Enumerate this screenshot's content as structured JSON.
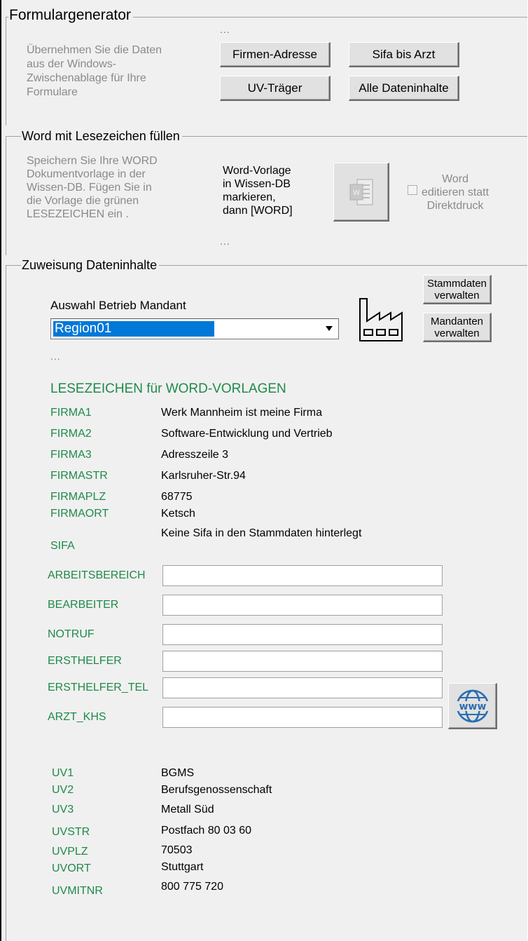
{
  "formulargenerator": {
    "title": "Formulargenerator",
    "desc_lines": [
      "Übernehmen Sie die Daten",
      "aus der Windows-",
      "Zwischenablage für Ihre",
      "Formulare"
    ],
    "dots": "...",
    "btn_firmen_adresse": "Firmen-Adresse",
    "btn_sifa_bis_arzt": "Sifa bis Arzt",
    "btn_uv_traeger": "UV-Träger",
    "btn_alle_dateninhalte": "Alle Dateninhalte"
  },
  "word_section": {
    "title": "Word mit Lesezeichen füllen",
    "desc_lines": [
      "Speichern Sie Ihre WORD",
      "Dokumentvorlage in der",
      "Wissen-DB. Fügen Sie in",
      "die Vorlage die grünen",
      "LESEZEICHEN ein ."
    ],
    "instr_lines": [
      "Word-Vorlage",
      "in Wissen-DB",
      "markieren,",
      "dann [WORD]"
    ],
    "word_button_icon": "word-icon",
    "checkbox_lines": [
      "Word",
      "editieren statt",
      "Direktdruck"
    ],
    "checkbox_checked": false,
    "dots": "..."
  },
  "zuweisung": {
    "title": "Zuweisung Dateninhalte",
    "auswahl_label": "Auswahl Betrieb Mandant",
    "selected_mandant": "Region01",
    "btn_stammdaten": [
      "Stammdaten",
      "verwalten"
    ],
    "btn_mandanten": [
      "Mandanten",
      "verwalten"
    ],
    "factory_icon": "factory-icon",
    "dots": "...",
    "lesezeichen_heading": "LESEZEICHEN für WORD-VORLAGEN",
    "firm_fields": [
      {
        "label": "FIRMA1",
        "value": "Werk Mannheim  ist meine Firma"
      },
      {
        "label": "FIRMA2",
        "value": "Software-Entwicklung und Vertrieb"
      },
      {
        "label": "FIRMA3",
        "value": "Adresszeile 3"
      },
      {
        "label": "FIRMASTR",
        "value": "Karlsruher-Str.94"
      },
      {
        "label": "FIRMAPLZ",
        "value": "68775"
      },
      {
        "label": "FIRMAORT",
        "value": "Ketsch"
      }
    ],
    "sifa_note": "Keine Sifa in den Stammdaten hinterlegt",
    "sifa_label": "SIFA",
    "input_fields": [
      {
        "label": "ARBEITSBEREICH",
        "value": ""
      },
      {
        "label": "BEARBEITER",
        "value": ""
      },
      {
        "label": "NOTRUF",
        "value": ""
      },
      {
        "label": "ERSTHELFER",
        "value": ""
      },
      {
        "label": "ERSTHELFER_TEL",
        "value": ""
      },
      {
        "label": "ARZT_KHS",
        "value": ""
      }
    ],
    "www_icon_text": "www",
    "uv_fields": [
      {
        "label": "UV1",
        "value": "BGMS"
      },
      {
        "label": "UV2",
        "value": "Berufsgenossenschaft"
      },
      {
        "label": "UV3",
        "value": "Metall Süd"
      },
      {
        "label": "UVSTR",
        "value": "Postfach 80 03 60"
      },
      {
        "label": "UVPLZ",
        "value": "70503"
      },
      {
        "label": "UVORT",
        "value": "Stuttgart"
      },
      {
        "label": "UVMITNR",
        "value": "800 775 720"
      }
    ]
  },
  "colors": {
    "bookmark_green": "#1f8a4a",
    "gray_text": "#8a8a8a",
    "selection_blue": "#0078d7"
  }
}
